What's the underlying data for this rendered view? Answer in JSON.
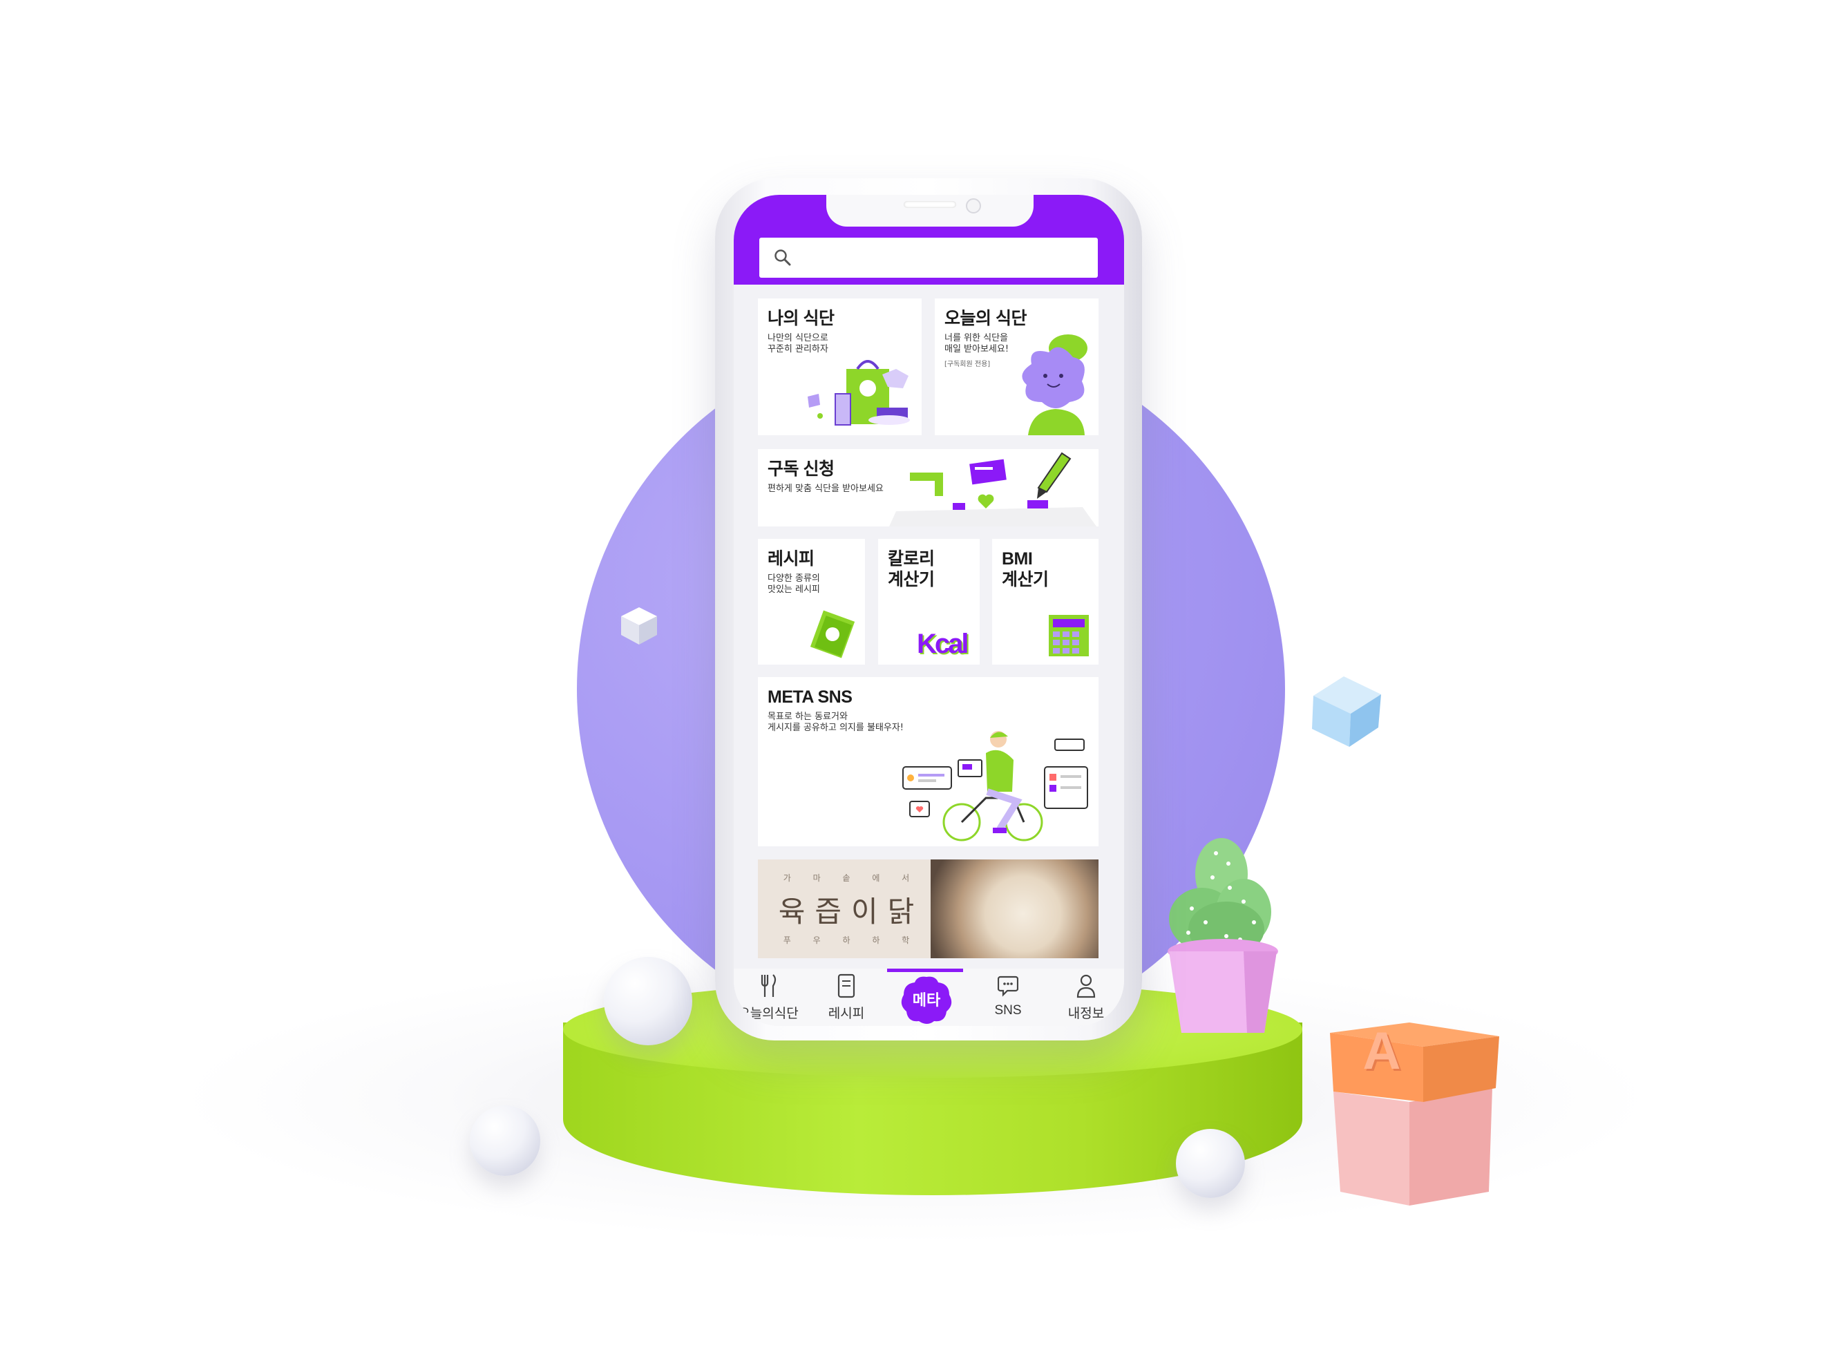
{
  "theme": {
    "primary": "#8b1af7",
    "accent": "#8ed629",
    "background": "#f2f2f6"
  },
  "search": {
    "icon": "search-icon",
    "placeholder": ""
  },
  "cards": {
    "my_meal": {
      "title": "나의 식단",
      "subtitle": "나만의 식단으로\n꾸준히 관리하자"
    },
    "today_meal": {
      "title": "오늘의 식단",
      "subtitle": "너를 위한 식단을\n매일 받아보세요!",
      "note": "[구독회원 전용]"
    },
    "subscribe": {
      "title": "구독 신청",
      "subtitle": "편하게 맞춤 식단을 받아보세요"
    },
    "recipe": {
      "title": "레시피",
      "subtitle": "다양한 종류의\n맛있는 레시피"
    },
    "kcal": {
      "title": "칼로리\n계산기",
      "mark": "Kcal"
    },
    "bmi": {
      "title": "BMI\n계산기"
    },
    "sns": {
      "title": "META SNS",
      "subtitle": "목표로 하는 동료거와\n게시지를 공유하고 의지를 불태우자!"
    },
    "banner": {
      "top": "가 마 솥 에 서",
      "main": "육즙이닭",
      "bottom": "푸 우 하 하 학"
    }
  },
  "nav": [
    {
      "label": "오늘의식단",
      "icon": "fork-knife-icon"
    },
    {
      "label": "레시피",
      "icon": "recipe-book-icon"
    },
    {
      "label": "메타",
      "icon": "meta-logo-icon",
      "active": true
    },
    {
      "label": "SNS",
      "icon": "chat-bubble-icon"
    },
    {
      "label": "내정보",
      "icon": "user-icon"
    }
  ],
  "block_letter": "A"
}
